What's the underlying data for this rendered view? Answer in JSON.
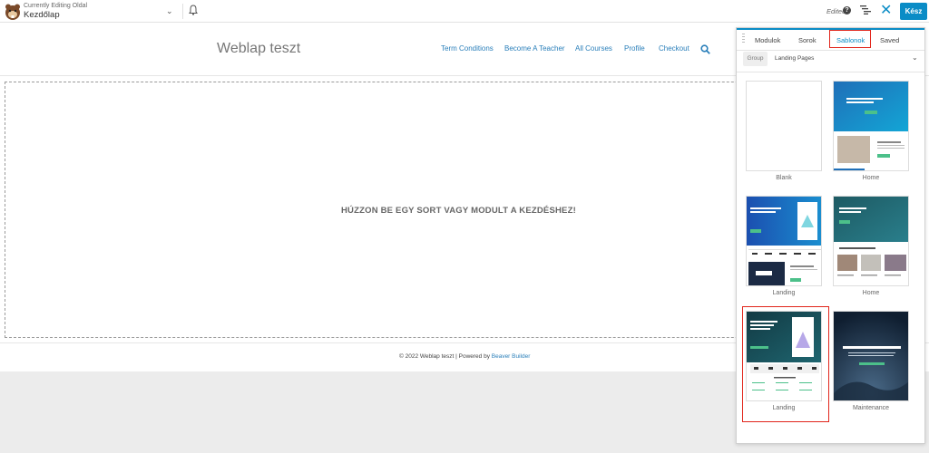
{
  "topbar": {
    "editing_small": "Currently Editing Oldal",
    "editing_title": "Kezdőlap",
    "edited": "Edited",
    "help": "?",
    "done_label": "Kész",
    "close_glyph": "✕",
    "chevron_glyph": "⌄",
    "icons": [
      "bell-icon",
      "outline-icon",
      "help-icon",
      "close-icon"
    ]
  },
  "site": {
    "title": "Weblap teszt",
    "nav": [
      "Term Conditions",
      "Become A Teacher",
      "All Courses",
      "Profile",
      "Checkout"
    ],
    "drop_text": "HÚZZON BE EGY SORT VAGY MODULT A KEZDÉSHEZ!",
    "footer_text": "© 2022 Weblap teszt | Powered by ",
    "footer_link": "Beaver Builder"
  },
  "panel": {
    "tabs": [
      "Modulok",
      "Sorok",
      "Sablonok",
      "Saved"
    ],
    "active_tab": "Sablonok",
    "group_label": "Group",
    "group_value": "Landing Pages",
    "chevron_glyph": "⌄",
    "templates": [
      {
        "label": "Blank",
        "style": "blank"
      },
      {
        "label": "Home",
        "style": "home1"
      },
      {
        "label": "Landing",
        "style": "landing1"
      },
      {
        "label": "Home",
        "style": "home2"
      },
      {
        "label": "Landing",
        "style": "landing2"
      },
      {
        "label": "Maintenance",
        "style": "maintenance"
      }
    ],
    "thumb_texts": {
      "landing2_heading": "Struggling to create effective designs with WordPress?",
      "landing2_sub": "What you will learn",
      "maintenance_heading": "We're making some exciting updates"
    }
  },
  "colors": {
    "accent": "#0a8cc6",
    "highlight": "#e1251b",
    "link": "#2a7fba"
  }
}
